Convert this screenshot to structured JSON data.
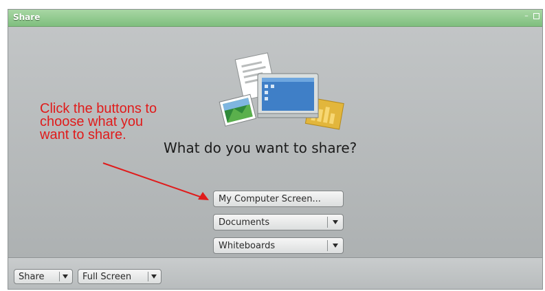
{
  "window": {
    "title": "Share"
  },
  "main": {
    "question": "What do you want to share?",
    "options": [
      {
        "label": "My Computer Screen..."
      },
      {
        "label": "Documents"
      },
      {
        "label": "Whiteboards"
      }
    ],
    "annotation": "Click the buttons to choose what you want to share."
  },
  "bottombar": {
    "share_label": "Share",
    "fullscreen_label": "Full Screen"
  },
  "colors": {
    "titlebar": "#8fca8d",
    "annotation": "#e01b1b",
    "panel": "#b5b8b9"
  },
  "icons": [
    "minimize-icon",
    "maximize-icon",
    "dropdown-arrow-icon",
    "share-illustration-icon",
    "annotation-arrow-icon"
  ]
}
